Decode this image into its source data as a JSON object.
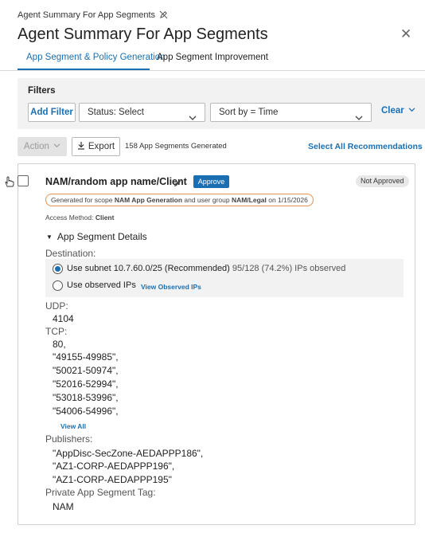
{
  "header": {
    "breadcrumb": "Agent Summary For App Segments",
    "title": "Agent Summary For App Segments",
    "close_glyph": "✕"
  },
  "tabs": [
    {
      "label": "App Segment & Policy Generation",
      "active": true
    },
    {
      "label": "App Segment Improvement",
      "active": false
    }
  ],
  "filters": {
    "label": "Filters",
    "add_filter": "Add Filter",
    "status_select": "Status: Select",
    "sort_select": "Sort by = Time",
    "clear": "Clear"
  },
  "toolbar": {
    "action": "Action",
    "export": "Export",
    "generated_count": "158 App Segments Generated",
    "select_all": "Select All Recommendations"
  },
  "segment": {
    "name": "NAM/random app name/Client",
    "approve": "Approve",
    "status_badge": "Not Approved",
    "scope_prefix": "Generated for scope ",
    "scope_name": "NAM App Generation",
    "scope_mid": " and user group ",
    "user_group": "NAM/Legal",
    "scope_suffix": " on 1/15/2026",
    "access_label": "Access Method: ",
    "access_value": "Client",
    "details_title": "App Segment Details",
    "destination_label": "Destination:",
    "option_subnet": "Use subnet 10.7.60.0/25 (Recommended)",
    "option_subnet_stats": "95/128 (74.2%) IPs observed",
    "option_observed": "Use observed IPs",
    "view_observed": "View Observed IPs",
    "udp_label": "UDP:",
    "udp_ports": [
      "4104"
    ],
    "tcp_label": "TCP:",
    "tcp_ports": [
      "80,",
      "\"49155-49985\",",
      "\"50021-50974\",",
      "\"52016-52994\",",
      "\"53018-53996\",",
      "\"54006-54996\","
    ],
    "view_all": "View All",
    "publishers_label": "Publishers:",
    "publishers": [
      "\"AppDisc-SecZone-AEDAPPP186\",",
      "\"AZ1-CORP-AEDAPPP196\",",
      "\"AZ1-CORP-AEDAPPP195\""
    ],
    "tag_label": "Private App Segment Tag:",
    "tag_value": "NAM"
  },
  "colors": {
    "accent": "#1a6fb3",
    "scope_border": "#e8914d",
    "panel_bg": "#f2f2f2"
  },
  "icons": [
    "pencil-off-icon",
    "close-icon",
    "chevron-down-icon",
    "export-icon",
    "hand-cursor-icon",
    "edit-pencil-icon",
    "triangle-down-icon"
  ]
}
